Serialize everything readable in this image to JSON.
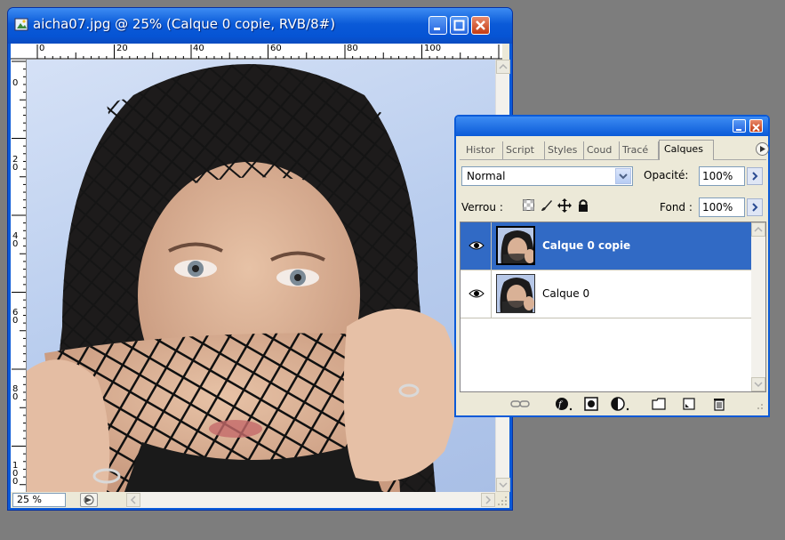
{
  "document_window": {
    "title": "aicha07.jpg @ 25% (Calque 0 copie, RVB/8#)",
    "ruler_h_labels": [
      "0",
      "20",
      "40",
      "60",
      "80",
      "100"
    ],
    "ruler_v_labels": [
      "0",
      "2\n0",
      "4\n0",
      "6\n0",
      "8\n0",
      "1\n0\n0"
    ],
    "zoom_level": "25 %",
    "colors": {
      "title_bar": "#0a5ad8",
      "close_button": "#c33b13"
    }
  },
  "layers_palette": {
    "tabs": [
      {
        "label": "Histor",
        "active": false
      },
      {
        "label": "Script",
        "active": false
      },
      {
        "label": "Styles",
        "active": false
      },
      {
        "label": "Coud",
        "active": false
      },
      {
        "label": "Tracé",
        "active": false
      },
      {
        "label": "Calques",
        "active": true
      }
    ],
    "blend_mode": "Normal",
    "opacity_label": "Opacité:",
    "opacity_value": "100%",
    "lock_label": "Verrou :",
    "fill_label": "Fond :",
    "fill_value": "100%",
    "layers": [
      {
        "name": "Calque 0 copie",
        "selected": true,
        "visible": true
      },
      {
        "name": "Calque 0",
        "selected": false,
        "visible": true
      }
    ],
    "colors": {
      "selection": "#316ac5",
      "panel_bg": "#ece9d8"
    },
    "bottom_icons": [
      "link-icon",
      "layer-style-icon",
      "mask-icon",
      "adjustment-layer-icon",
      "folder-icon",
      "new-layer-icon",
      "trash-icon"
    ]
  }
}
